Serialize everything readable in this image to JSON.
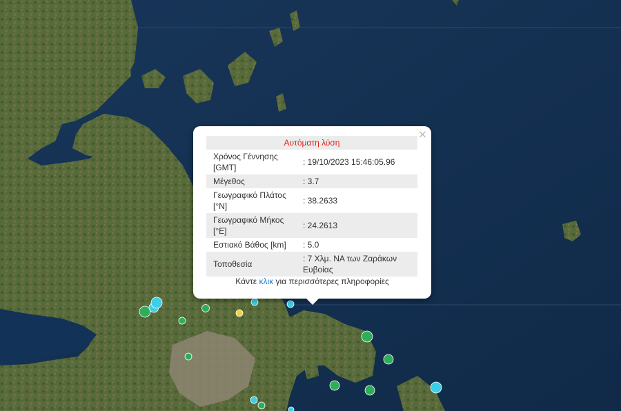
{
  "popup": {
    "close_label": "×",
    "title": "Αυτόματη λύση",
    "rows": [
      {
        "label": "Χρόνος Γέννησης [GMT]",
        "value": ": 19/10/2023 15:46:05.96"
      },
      {
        "label": "Μέγεθος",
        "value": ": 3.7"
      },
      {
        "label": "Γεωγραφικό Πλάτος [°N]",
        "value": ": 38.2633"
      },
      {
        "label": "Γεωγραφικό Μήκος [°E]",
        "value": ": 24.2613"
      },
      {
        "label": "Εστιακό Βάθος [km]",
        "value": ": 5.0"
      },
      {
        "label": "Τοποθεσία",
        "value": ": 7 Χλμ. ΝΑ των Ζαράκων Ευβοίας"
      }
    ],
    "more_prefix": "Κάντε ",
    "more_link": "κλικ",
    "more_suffix": " για περισσότερες πληροφορίες"
  },
  "map": {
    "colors": {
      "sea": "#14304f",
      "land": "#4f6136",
      "land_dark": "#3d4f2a",
      "urban": "#9a8f7d",
      "dot_green": "#2fae5a",
      "dot_cyan": "#3ccfe6",
      "dot_yellow": "#f0d23a"
    }
  }
}
